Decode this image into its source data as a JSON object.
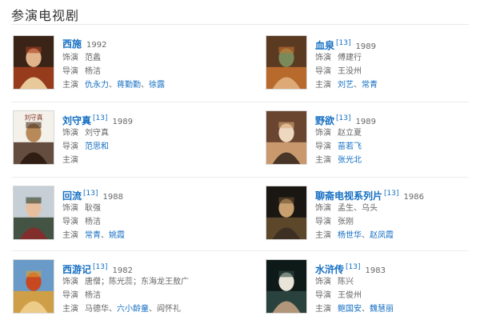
{
  "section": {
    "title": "参演电视剧"
  },
  "labels": {
    "role": "饰演",
    "director": "导演",
    "cast": "主演"
  },
  "shows": [
    {
      "title": "西施",
      "ref": "",
      "year": "1992",
      "role": [
        {
          "text": "范蠡",
          "link": false
        }
      ],
      "director": [
        {
          "text": "杨洁",
          "link": false
        }
      ],
      "cast": [
        {
          "text": "仇永力",
          "link": true
        },
        {
          "text": "、",
          "link": false
        },
        {
          "text": "蒋勤勤",
          "link": true
        },
        {
          "text": "、",
          "link": false
        },
        {
          "text": "徐露",
          "link": true
        }
      ],
      "colors": [
        "#3a2418",
        "#a8401e",
        "#e2b48c",
        "#f0d9a8"
      ]
    },
    {
      "title": "血泉",
      "ref": "[13]",
      "year": "1989",
      "role": [
        {
          "text": "傅建行",
          "link": false
        }
      ],
      "director": [
        {
          "text": "王没州",
          "link": false
        }
      ],
      "cast": [
        {
          "text": "刘艺",
          "link": true
        },
        {
          "text": "、",
          "link": false
        },
        {
          "text": "常青",
          "link": true
        }
      ],
      "colors": [
        "#5b3a22",
        "#c9732e",
        "#7a8a5a",
        "#e0b080"
      ]
    },
    {
      "title": "刘守真",
      "ref": "[13]",
      "year": "1989",
      "role": [
        {
          "text": "刘守真",
          "link": false
        }
      ],
      "director": [
        {
          "text": "范思和",
          "link": true
        }
      ],
      "cast": [],
      "poster_caption": "刘守真",
      "colors": [
        "#f4f0ea",
        "#4a3020",
        "#b88a5a",
        "#2a1a10"
      ]
    },
    {
      "title": "野欲",
      "ref": "[13]",
      "year": "1989",
      "role": [
        {
          "text": "赵立夏",
          "link": false
        }
      ],
      "director": [
        {
          "text": "苗若飞",
          "link": true
        }
      ],
      "cast": [
        {
          "text": "张光北",
          "link": true
        }
      ],
      "colors": [
        "#6a4530",
        "#d9a878",
        "#eed8c0",
        "#3a2a20"
      ]
    },
    {
      "title": "回流",
      "ref": "[13]",
      "year": "1988",
      "role": [
        {
          "text": "耿强",
          "link": false
        }
      ],
      "director": [
        {
          "text": "杨洁",
          "link": false
        }
      ],
      "cast": [
        {
          "text": "常青",
          "link": true
        },
        {
          "text": "、",
          "link": false
        },
        {
          "text": "姚霞",
          "link": true
        }
      ],
      "colors": [
        "#c7cfd6",
        "#2c3e2a",
        "#e8c0a0",
        "#8a2a2a"
      ]
    },
    {
      "title": "聊斋电视系列片",
      "ref": "[13]",
      "year": "1986",
      "role": [
        {
          "text": "孟生、乌头",
          "link": false
        }
      ],
      "director": [
        {
          "text": "张刚",
          "link": false
        }
      ],
      "cast": [
        {
          "text": "杨世华",
          "link": true
        },
        {
          "text": "、",
          "link": false
        },
        {
          "text": "赵凤霞",
          "link": true
        }
      ],
      "colors": [
        "#1a1612",
        "#6a5030",
        "#c8a070",
        "#3a2e22"
      ]
    },
    {
      "title": "西游记",
      "ref": "[13]",
      "year": "1982",
      "role": [
        {
          "text": "唐僧；陈光蕊；东海龙王敖广",
          "link": false
        }
      ],
      "director": [
        {
          "text": "杨洁",
          "link": false
        }
      ],
      "cast": [
        {
          "text": "马德华",
          "link": false
        },
        {
          "text": "、",
          "link": false
        },
        {
          "text": "六小龄童",
          "link": true
        },
        {
          "text": "、",
          "link": false
        },
        {
          "text": "阎怀礼",
          "link": false
        }
      ],
      "colors": [
        "#6a9ac8",
        "#e0a030",
        "#c84820",
        "#f0d090"
      ]
    },
    {
      "title": "水浒传",
      "ref": "[13]",
      "year": "1983",
      "role": [
        {
          "text": "陈兴",
          "link": false
        }
      ],
      "director": [
        {
          "text": "王俊州",
          "link": false
        }
      ],
      "cast": [
        {
          "text": "鲍国安",
          "link": true
        },
        {
          "text": "、",
          "link": false
        },
        {
          "text": "魏慧丽",
          "link": true
        }
      ],
      "colors": [
        "#0e1a18",
        "#2e4a44",
        "#e8e4d8",
        "#c0a080"
      ]
    }
  ]
}
